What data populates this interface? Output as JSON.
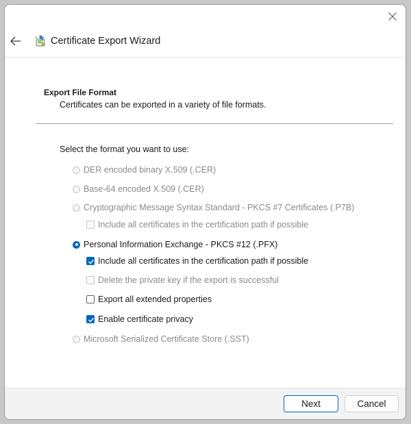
{
  "window": {
    "title": "Certificate Export Wizard"
  },
  "icons": {
    "close": "close-icon",
    "back": "back-arrow-icon",
    "wizard": "certificate-wizard-icon",
    "checkmark": "checkmark-icon"
  },
  "page": {
    "section_title": "Export File Format",
    "section_description": "Certificates can be exported in a variety of file formats.",
    "prompt": "Select the format you want to use:"
  },
  "formats": [
    {
      "label": "DER encoded binary X.509 (.CER)",
      "selected": false,
      "enabled": false
    },
    {
      "label": "Base-64 encoded X.509 (.CER)",
      "selected": false,
      "enabled": false
    },
    {
      "label": "Cryptographic Message Syntax Standard - PKCS #7 Certificates (.P7B)",
      "selected": false,
      "enabled": false
    },
    {
      "label": "Personal Information Exchange - PKCS #12 (.PFX)",
      "selected": true,
      "enabled": true
    },
    {
      "label": "Microsoft Serialized Certificate Store (.SST)",
      "selected": false,
      "enabled": false
    }
  ],
  "p7b_options": [
    {
      "label": "Include all certificates in the certification path if possible",
      "checked": false,
      "enabled": false
    }
  ],
  "pfx_options": [
    {
      "label": "Include all certificates in the certification path if possible",
      "checked": true,
      "enabled": true
    },
    {
      "label": "Delete the private key if the export is successful",
      "checked": false,
      "enabled": false
    },
    {
      "label": "Export all extended properties",
      "checked": false,
      "enabled": true
    },
    {
      "label": "Enable certificate privacy",
      "checked": true,
      "enabled": true
    }
  ],
  "buttons": {
    "next": "Next",
    "cancel": "Cancel"
  },
  "colors": {
    "accent": "#0067c0",
    "disabled_text": "#8a8a8a",
    "footer_bg": "#f3f3f3"
  }
}
